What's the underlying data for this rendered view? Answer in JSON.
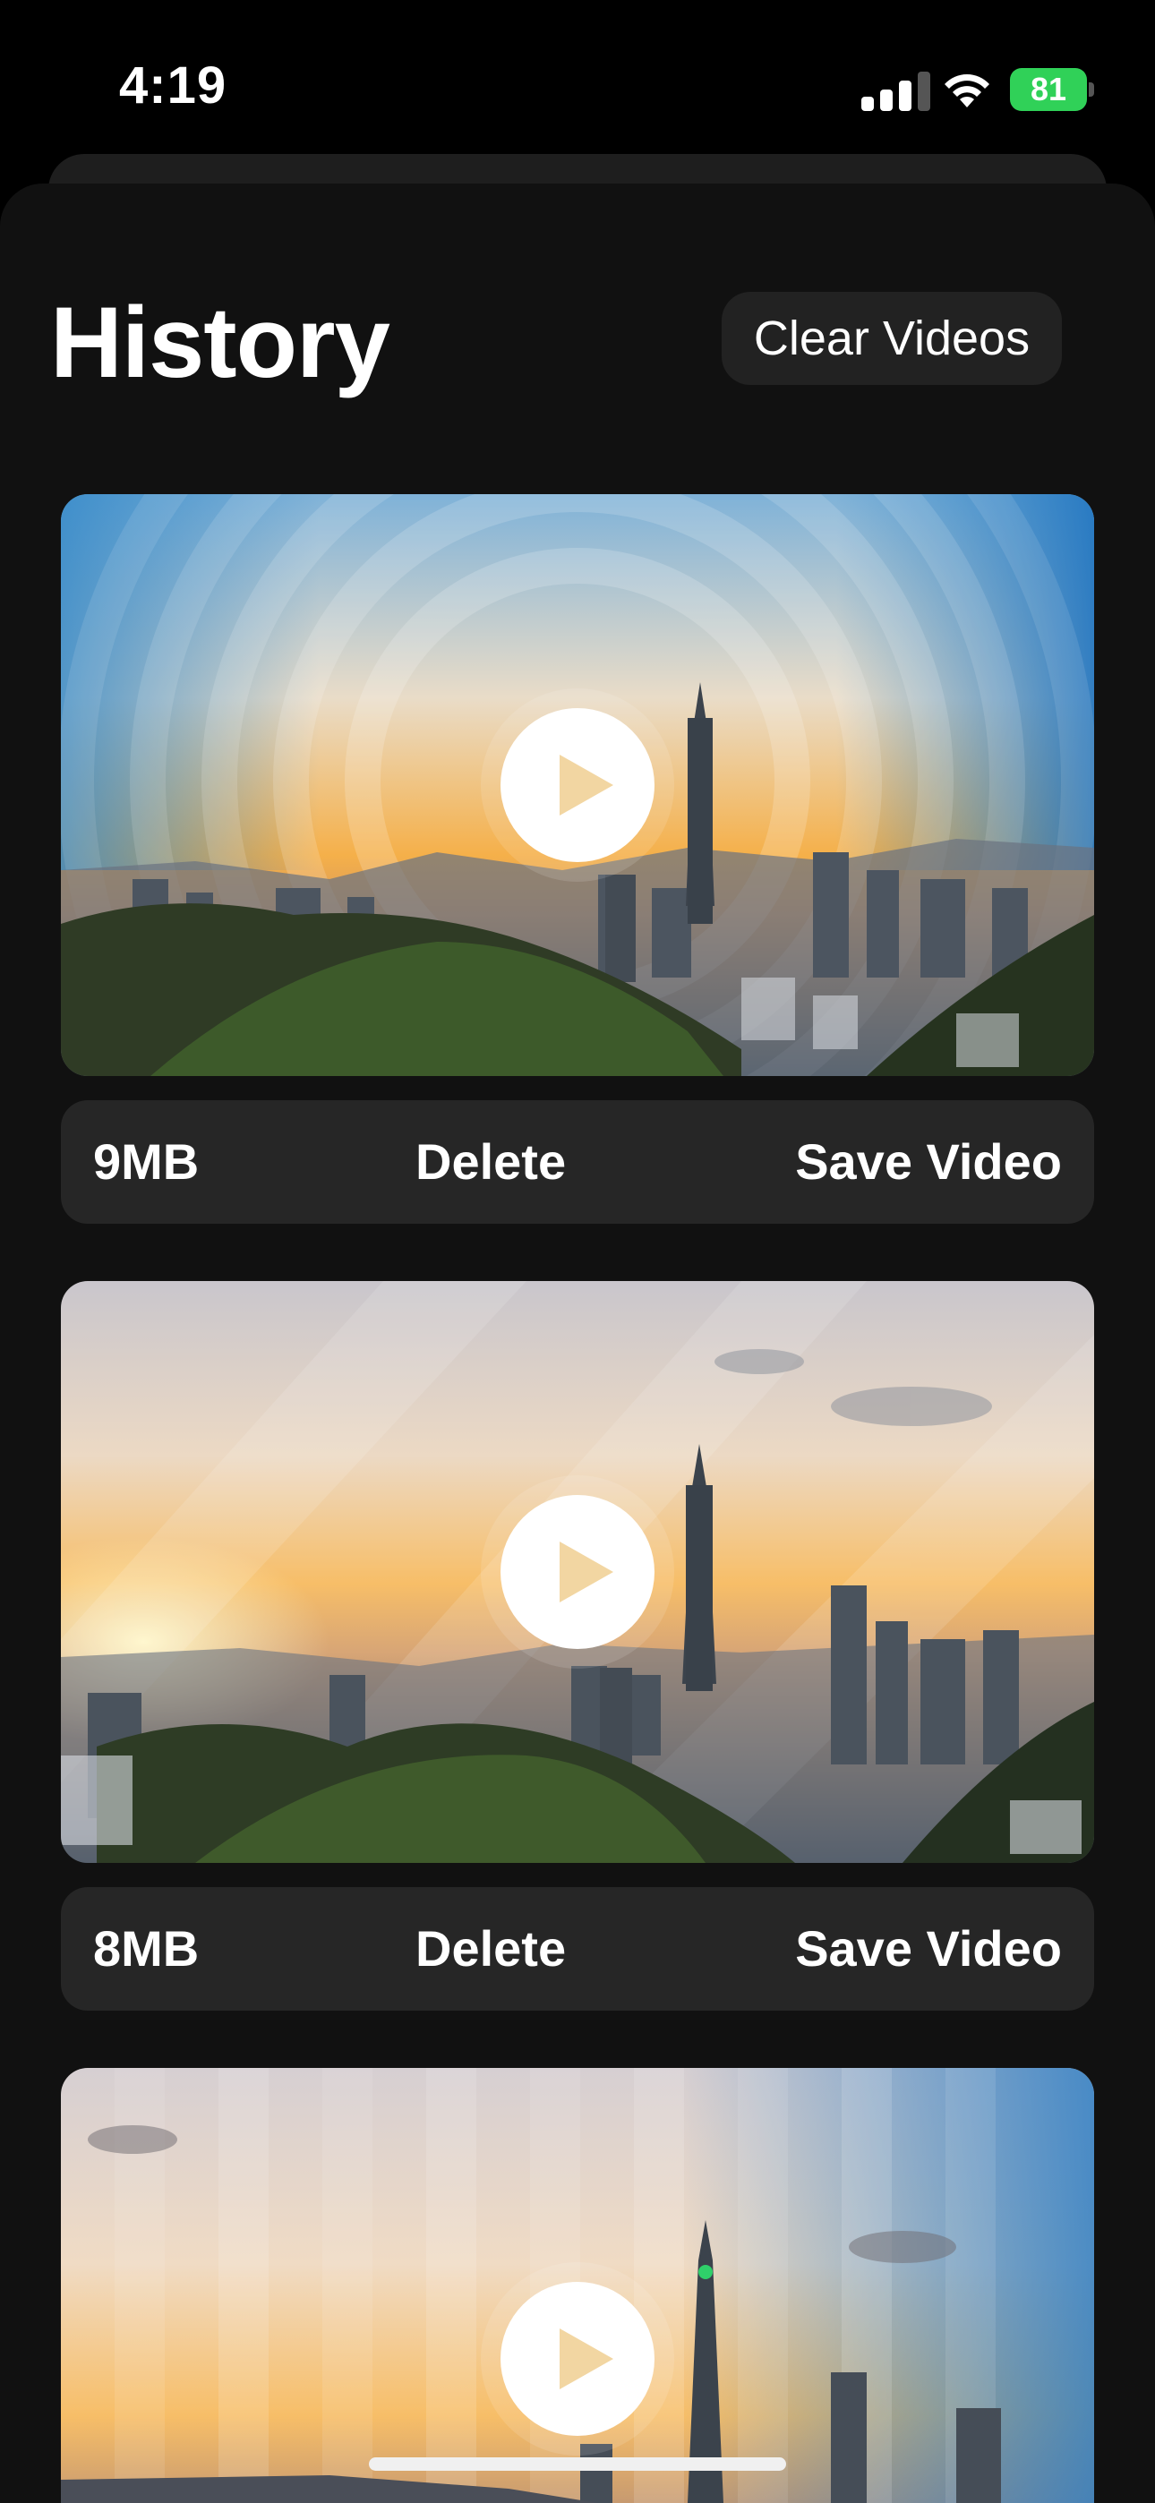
{
  "status_bar": {
    "time": "4:19",
    "battery": "81",
    "battery_color": "#30d158"
  },
  "header": {
    "title": "History",
    "clear_label": "Clear Videos"
  },
  "videos": [
    {
      "size": "9MB",
      "delete_label": "Delete",
      "save_label": "Save Video",
      "effect": "radial-rings"
    },
    {
      "size": "8MB",
      "delete_label": "Delete",
      "save_label": "Save Video",
      "effect": "diagonal-stripes"
    },
    {
      "effect": "vertical-stripes"
    }
  ],
  "icons": {
    "play": "play-icon",
    "signal": "cellular-signal-icon",
    "wifi": "wifi-icon",
    "battery": "battery-charging-icon"
  }
}
